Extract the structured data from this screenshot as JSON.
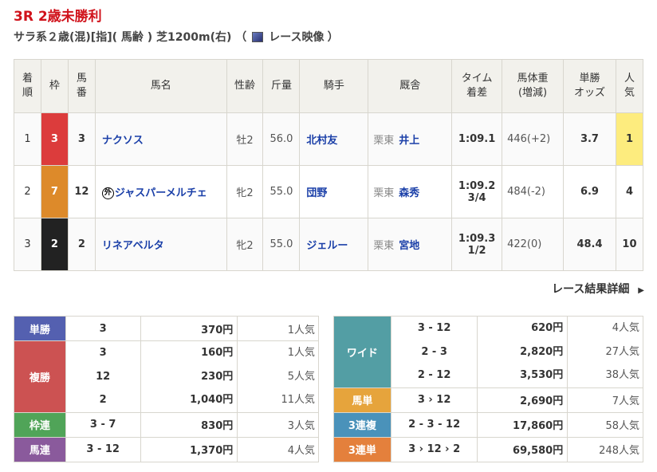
{
  "race": {
    "title": "3R 2歳未勝利",
    "condition_prefix": "サラ系２歳(混)[指]( 馬齢 ) 芝1200m(右) （",
    "video_label": "レース映像",
    "condition_suffix": "）"
  },
  "headers": [
    "着\n順",
    "枠",
    "馬\n番",
    "馬名",
    "性齢",
    "斤量",
    "騎手",
    "厩舎",
    "タイム\n着差",
    "馬体重\n(増減)",
    "単勝\nオッズ",
    "人\n気"
  ],
  "rows": [
    {
      "rank": "1",
      "waku": "3",
      "waku_color": "#dc3c3c",
      "num": "3",
      "foreign": "",
      "name": "ナクソス",
      "sex_age": "牡2",
      "weight": "56.0",
      "jockey": "北村友",
      "region": "栗東",
      "trainer": "井上",
      "time": "1:09.1",
      "margin": "",
      "body": "446(+2)",
      "odds": "3.7",
      "pop": "1"
    },
    {
      "rank": "2",
      "waku": "7",
      "waku_color": "#dd8a2a",
      "num": "12",
      "foreign": "外",
      "name": "ジャスパーメルチェ",
      "sex_age": "牝2",
      "weight": "55.0",
      "jockey": "団野",
      "region": "栗東",
      "trainer": "森秀",
      "time": "1:09.2",
      "margin": "3/4",
      "body": "484(-2)",
      "odds": "6.9",
      "pop": "4"
    },
    {
      "rank": "3",
      "waku": "2",
      "waku_color": "#222222",
      "num": "2",
      "foreign": "",
      "name": "リネアベルタ",
      "sex_age": "牝2",
      "weight": "55.0",
      "jockey": "ジェルー",
      "region": "栗東",
      "trainer": "宮地",
      "time": "1:09.3",
      "margin": "1/2",
      "body": "422(0)",
      "odds": "48.4",
      "pop": "10"
    }
  ],
  "detail_link": "レース結果詳細",
  "payouts_left": [
    {
      "label": "単勝",
      "color": "#5460b0",
      "items": [
        {
          "combo": "3",
          "yen": "370円",
          "pop": "1人気"
        }
      ]
    },
    {
      "label": "複勝",
      "color": "#cc5252",
      "items": [
        {
          "combo": "3",
          "yen": "160円",
          "pop": "1人気"
        },
        {
          "combo": "12",
          "yen": "230円",
          "pop": "5人気"
        },
        {
          "combo": "2",
          "yen": "1,040円",
          "pop": "11人気"
        }
      ]
    },
    {
      "label": "枠連",
      "color": "#50a458",
      "items": [
        {
          "combo": "3 - 7",
          "yen": "830円",
          "pop": "3人気"
        }
      ]
    },
    {
      "label": "馬連",
      "color": "#8a5a9c",
      "items": [
        {
          "combo": "3 - 12",
          "yen": "1,370円",
          "pop": "4人気"
        }
      ]
    }
  ],
  "payouts_right": [
    {
      "label": "ワイド",
      "color": "#539ea4",
      "items": [
        {
          "combo": "3 - 12",
          "yen": "620円",
          "pop": "4人気"
        },
        {
          "combo": "2 - 3",
          "yen": "2,820円",
          "pop": "27人気"
        },
        {
          "combo": "2 - 12",
          "yen": "3,530円",
          "pop": "38人気"
        }
      ]
    },
    {
      "label": "馬単",
      "color": "#e6a43c",
      "items": [
        {
          "combo": "3 › 12",
          "yen": "2,690円",
          "pop": "7人気"
        }
      ]
    },
    {
      "label": "3連複",
      "color": "#4a92ba",
      "items": [
        {
          "combo": "2 - 3 - 12",
          "yen": "17,860円",
          "pop": "58人気"
        }
      ]
    },
    {
      "label": "3連単",
      "color": "#e4803c",
      "items": [
        {
          "combo": "3 › 12 › 2",
          "yen": "69,580円",
          "pop": "248人気"
        }
      ]
    }
  ]
}
